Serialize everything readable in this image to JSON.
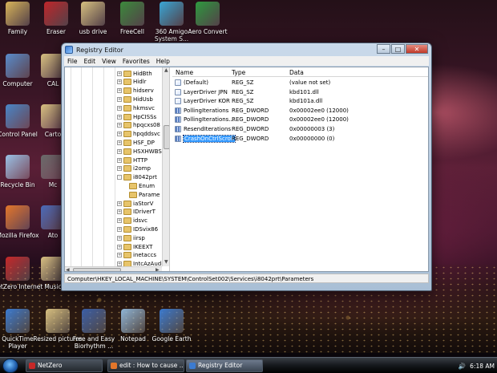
{
  "desktop_icons": [
    {
      "label": "Family"
    },
    {
      "label": "Eraser"
    },
    {
      "label": "usb drive"
    },
    {
      "label": "FreeCell"
    },
    {
      "label": "360 Amigo System S..."
    },
    {
      "label": "Aero Convert"
    },
    {
      "label": "Computer"
    },
    {
      "label": "CAL"
    },
    {
      "label": "Control Panel"
    },
    {
      "label": "Carto"
    },
    {
      "label": "Recycle Bin"
    },
    {
      "label": "Mc"
    },
    {
      "label": "Mozilla Firefox"
    },
    {
      "label": "Ato"
    },
    {
      "label": "NetZero Internet"
    },
    {
      "label": "Music"
    },
    {
      "label": "QuickTime Player"
    },
    {
      "label": "Resized pictures"
    },
    {
      "label": "Free and Easy Biorhythm ..."
    },
    {
      "label": "Notepad"
    },
    {
      "label": "Google Earth"
    }
  ],
  "window": {
    "title": "Registry Editor",
    "menu": [
      "File",
      "Edit",
      "View",
      "Favorites",
      "Help"
    ],
    "tree_items": [
      {
        "label": "HidBth",
        "open": false
      },
      {
        "label": "Hidlr",
        "open": false
      },
      {
        "label": "hidserv",
        "open": false
      },
      {
        "label": "HidUsb",
        "open": false
      },
      {
        "label": "hkmsvc",
        "open": false
      },
      {
        "label": "HpCISSs",
        "open": false
      },
      {
        "label": "hpqcxs08",
        "open": false
      },
      {
        "label": "hpqddsvc",
        "open": false
      },
      {
        "label": "HSF_DP",
        "open": false
      },
      {
        "label": "HSXHWBS",
        "open": false
      },
      {
        "label": "HTTP",
        "open": false
      },
      {
        "label": "i2omp",
        "open": false
      },
      {
        "label": "i8042prt",
        "open": true
      },
      {
        "label": "Enum",
        "child": true
      },
      {
        "label": "Parame",
        "child": true
      },
      {
        "label": "iaStorV",
        "open": false
      },
      {
        "label": "IDriverT",
        "open": false
      },
      {
        "label": "idsvc",
        "open": false
      },
      {
        "label": "IDSvix86",
        "open": false
      },
      {
        "label": "iirsp",
        "open": false
      },
      {
        "label": "IKEEXT",
        "open": false
      },
      {
        "label": "inetaccs",
        "open": false
      },
      {
        "label": "IntcAzAudi",
        "open": false
      }
    ],
    "columns": {
      "name": "Name",
      "type": "Type",
      "data": "Data"
    },
    "values": [
      {
        "name": "(Default)",
        "type": "REG_SZ",
        "data": "(value not set)",
        "kind": "sz"
      },
      {
        "name": "LayerDriver JPN",
        "type": "REG_SZ",
        "data": "kbd101.dll",
        "kind": "sz"
      },
      {
        "name": "LayerDriver KOR",
        "type": "REG_SZ",
        "data": "kbd101a.dll",
        "kind": "sz"
      },
      {
        "name": "PollingIterations",
        "type": "REG_DWORD",
        "data": "0x00002ee0 (12000)",
        "kind": "dw"
      },
      {
        "name": "PollingIterations...",
        "type": "REG_DWORD",
        "data": "0x00002ee0 (12000)",
        "kind": "dw"
      },
      {
        "name": "ResendIterations",
        "type": "REG_DWORD",
        "data": "0x00000003 (3)",
        "kind": "dw"
      },
      {
        "name": "CrashOnCtrlScroll",
        "type": "REG_DWORD",
        "data": "0x00000000 (0)",
        "kind": "dw",
        "selected": true
      }
    ],
    "status_path": "Computer\\HKEY_LOCAL_MACHINE\\SYSTEM\\ControlSet002\\Services\\i8042prt\\Parameters"
  },
  "taskbar": {
    "buttons": [
      {
        "label": "NetZero",
        "active": false
      },
      {
        "label": "edit : How to cause ...",
        "active": false
      },
      {
        "label": "Registry Editor",
        "active": true
      }
    ],
    "clock": "6:18 AM"
  },
  "colors": {
    "selection": "#3399ff",
    "taskbar": "#15181c"
  }
}
